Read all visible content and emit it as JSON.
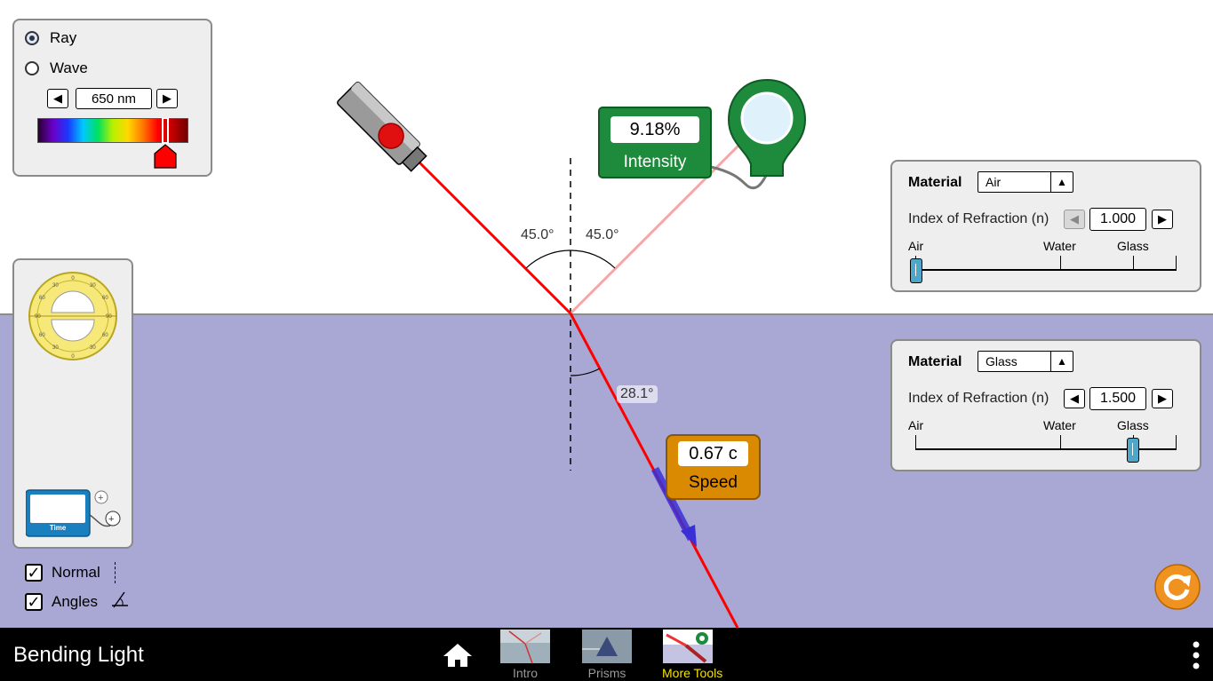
{
  "app": {
    "title": "Bending Light"
  },
  "light_mode": {
    "options": [
      {
        "label": "Ray",
        "selected": true
      },
      {
        "label": "Wave",
        "selected": false
      }
    ]
  },
  "wavelength": {
    "value": "650 nm",
    "spectrum_fraction": 0.84
  },
  "angles": {
    "incident": "45.0°",
    "reflected": "45.0°",
    "refracted": "28.1°"
  },
  "intensity_meter": {
    "value": "9.18%",
    "label": "Intensity"
  },
  "speed_meter": {
    "value": "0.67 c",
    "label": "Speed"
  },
  "top_material": {
    "label": "Material",
    "selected": "Air",
    "ior_label": "Index of Refraction (n)",
    "ior_value": "1.000",
    "scale": [
      "Air",
      "Water",
      "Glass"
    ],
    "slider_fraction": 0.0
  },
  "bottom_material": {
    "label": "Material",
    "selected": "Glass",
    "ior_label": "Index of Refraction (n)",
    "ior_value": "1.500",
    "scale": [
      "Air",
      "Water",
      "Glass"
    ],
    "slider_fraction": 0.83
  },
  "toolbox": {
    "timer_label": "Time"
  },
  "checkboxes": [
    {
      "label": "Normal",
      "checked": true
    },
    {
      "label": "Angles",
      "checked": true
    }
  ],
  "screens": [
    {
      "label": "Intro",
      "active": false
    },
    {
      "label": "Prisms",
      "active": false
    },
    {
      "label": "More Tools",
      "active": true
    }
  ],
  "colors": {
    "laser": "#ff0000",
    "reflected": "#f6a6a6",
    "water": "#a9a7d4",
    "meter_green": "#1e8a3c",
    "speed_orange": "#d98a00",
    "reset_orange": "#f0921f"
  }
}
